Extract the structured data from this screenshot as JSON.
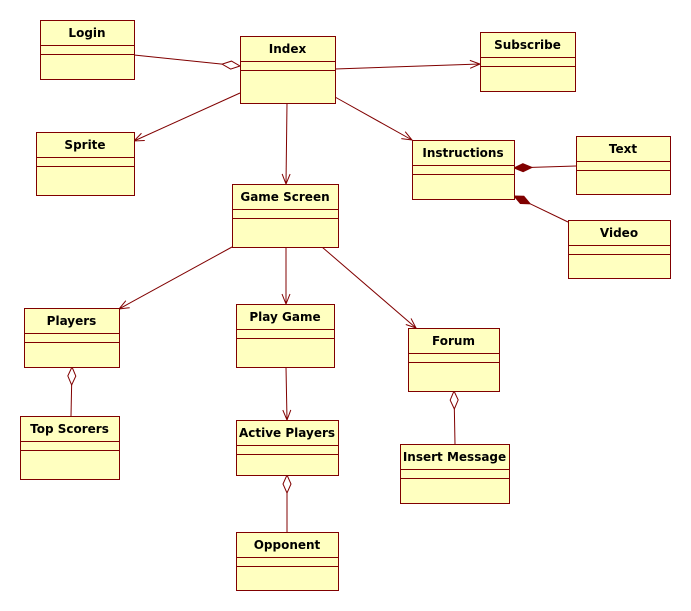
{
  "diagram": {
    "type": "uml-class-diagram",
    "colors": {
      "fill": "#ffffc0",
      "stroke": "#800000",
      "text": "#000000"
    },
    "classes": [
      {
        "id": "login",
        "name": "Login"
      },
      {
        "id": "index",
        "name": "Index"
      },
      {
        "id": "subscribe",
        "name": "Subscribe"
      },
      {
        "id": "sprite",
        "name": "Sprite"
      },
      {
        "id": "instructions",
        "name": "Instructions"
      },
      {
        "id": "text",
        "name": "Text"
      },
      {
        "id": "game-screen",
        "name": "Game Screen"
      },
      {
        "id": "video",
        "name": "Video"
      },
      {
        "id": "players",
        "name": "Players"
      },
      {
        "id": "play-game",
        "name": "Play Game"
      },
      {
        "id": "forum",
        "name": "Forum"
      },
      {
        "id": "top-scorers",
        "name": "Top Scorers"
      },
      {
        "id": "active-players",
        "name": "Active Players"
      },
      {
        "id": "insert-message",
        "name": "Insert Message"
      },
      {
        "id": "opponent",
        "name": "Opponent"
      }
    ],
    "relationships": [
      {
        "from": "login",
        "to": "index",
        "type": "aggregation"
      },
      {
        "from": "index",
        "to": "sprite",
        "type": "association"
      },
      {
        "from": "index",
        "to": "subscribe",
        "type": "association"
      },
      {
        "from": "index",
        "to": "instructions",
        "type": "association"
      },
      {
        "from": "index",
        "to": "game-screen",
        "type": "association"
      },
      {
        "from": "text",
        "to": "instructions",
        "type": "composition"
      },
      {
        "from": "video",
        "to": "instructions",
        "type": "composition"
      },
      {
        "from": "game-screen",
        "to": "players",
        "type": "association"
      },
      {
        "from": "game-screen",
        "to": "play-game",
        "type": "association"
      },
      {
        "from": "game-screen",
        "to": "forum",
        "type": "association"
      },
      {
        "from": "top-scorers",
        "to": "players",
        "type": "aggregation"
      },
      {
        "from": "play-game",
        "to": "active-players",
        "type": "association"
      },
      {
        "from": "opponent",
        "to": "active-players",
        "type": "aggregation"
      },
      {
        "from": "insert-message",
        "to": "forum",
        "type": "aggregation"
      }
    ]
  }
}
